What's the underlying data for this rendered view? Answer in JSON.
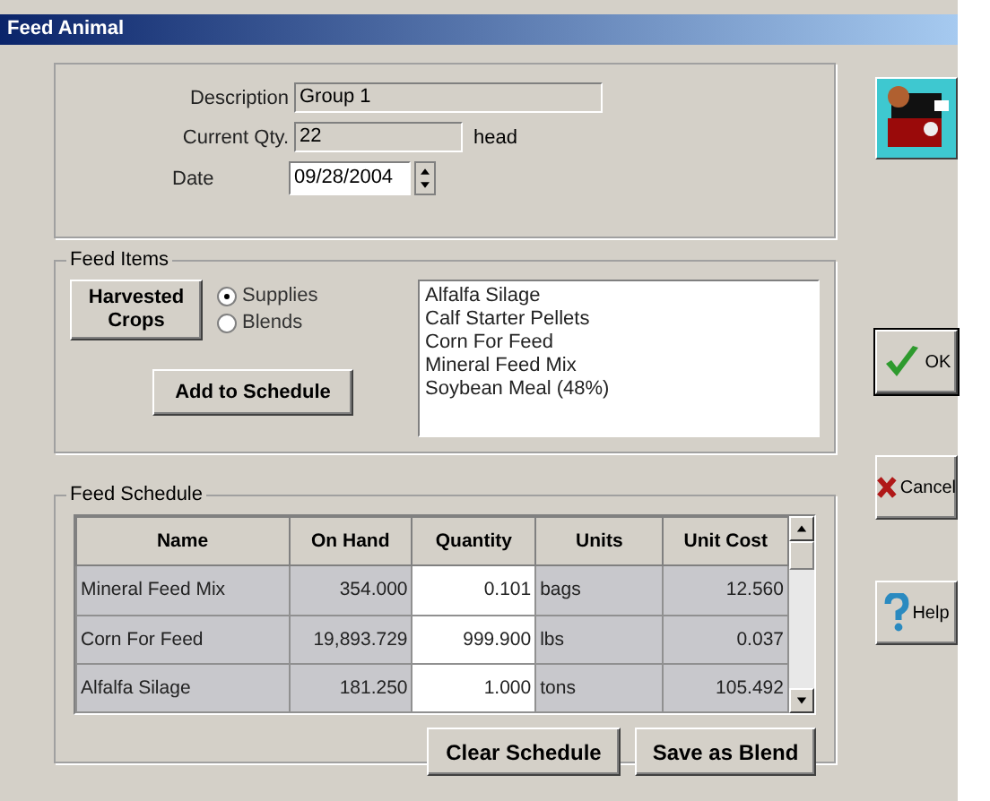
{
  "window": {
    "title": "Feed Animal"
  },
  "details": {
    "description_label": "Description",
    "description": "Group 1",
    "qty_label": "Current Qty.",
    "qty": "22",
    "qty_unit": "head",
    "date_label": "Date",
    "date": "09/28/2004"
  },
  "feed_items": {
    "title": "Feed Items",
    "source_button": "Harvested Crops",
    "options": [
      {
        "label": "Supplies",
        "selected": true
      },
      {
        "label": "Blends",
        "selected": false
      }
    ],
    "add_button": "Add to Schedule",
    "items": [
      "Alfalfa Silage",
      "Calf Starter Pellets",
      "Corn For Feed",
      "Mineral Feed Mix",
      "Soybean Meal (48%)"
    ]
  },
  "schedule": {
    "title": "Feed Schedule",
    "columns": [
      "Name",
      "On Hand",
      "Quantity",
      "Units",
      "Unit Cost"
    ],
    "rows": [
      [
        "Mineral Feed Mix",
        "354.000",
        "0.101",
        "bags",
        "12.560"
      ],
      [
        "Corn For Feed",
        "19,893.729",
        "999.900",
        "lbs",
        "0.037"
      ],
      [
        "Alfalfa Silage",
        "181.250",
        "1.000",
        "tons",
        "105.492"
      ]
    ],
    "buttons": [
      "Clear Schedule",
      "Save as Blend"
    ]
  },
  "side_buttons": [
    {
      "kind": "ok",
      "label": "OK"
    },
    {
      "kind": "cancel",
      "label": "Cancel"
    },
    {
      "kind": "help",
      "label": "Help"
    }
  ]
}
